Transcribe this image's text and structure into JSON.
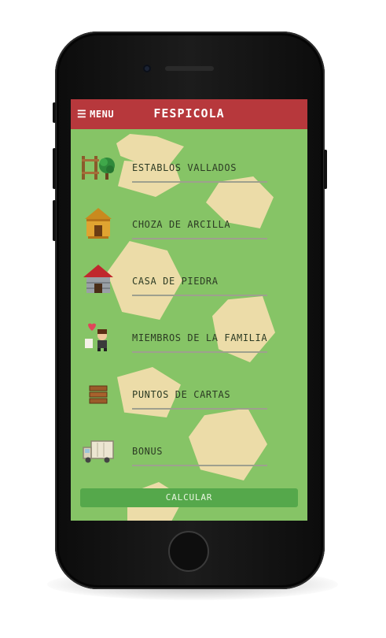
{
  "app": {
    "title": "FESPICOLA",
    "menu_label": "MENU",
    "menu_icon": "hamburger-icon",
    "header_color": "#b7383c",
    "background_color": "#86c466",
    "accent_button_color": "#55a84b"
  },
  "items": [
    {
      "label": "ESTABLOS VALLADOS",
      "icon": "fenced-stable-icon"
    },
    {
      "label": "CHOZA DE ARCILLA",
      "icon": "clay-hut-icon"
    },
    {
      "label": "CASA DE PIEDRA",
      "icon": "stone-house-icon"
    },
    {
      "label": "MIEMBROS DE LA FAMILIA",
      "icon": "family-member-icon"
    },
    {
      "label": "PUNTOS DE CARTAS",
      "icon": "card-stack-icon"
    },
    {
      "label": "BONUS",
      "icon": "bonus-truck-icon"
    }
  ],
  "calculate_button": {
    "label": "CALCULAR"
  }
}
